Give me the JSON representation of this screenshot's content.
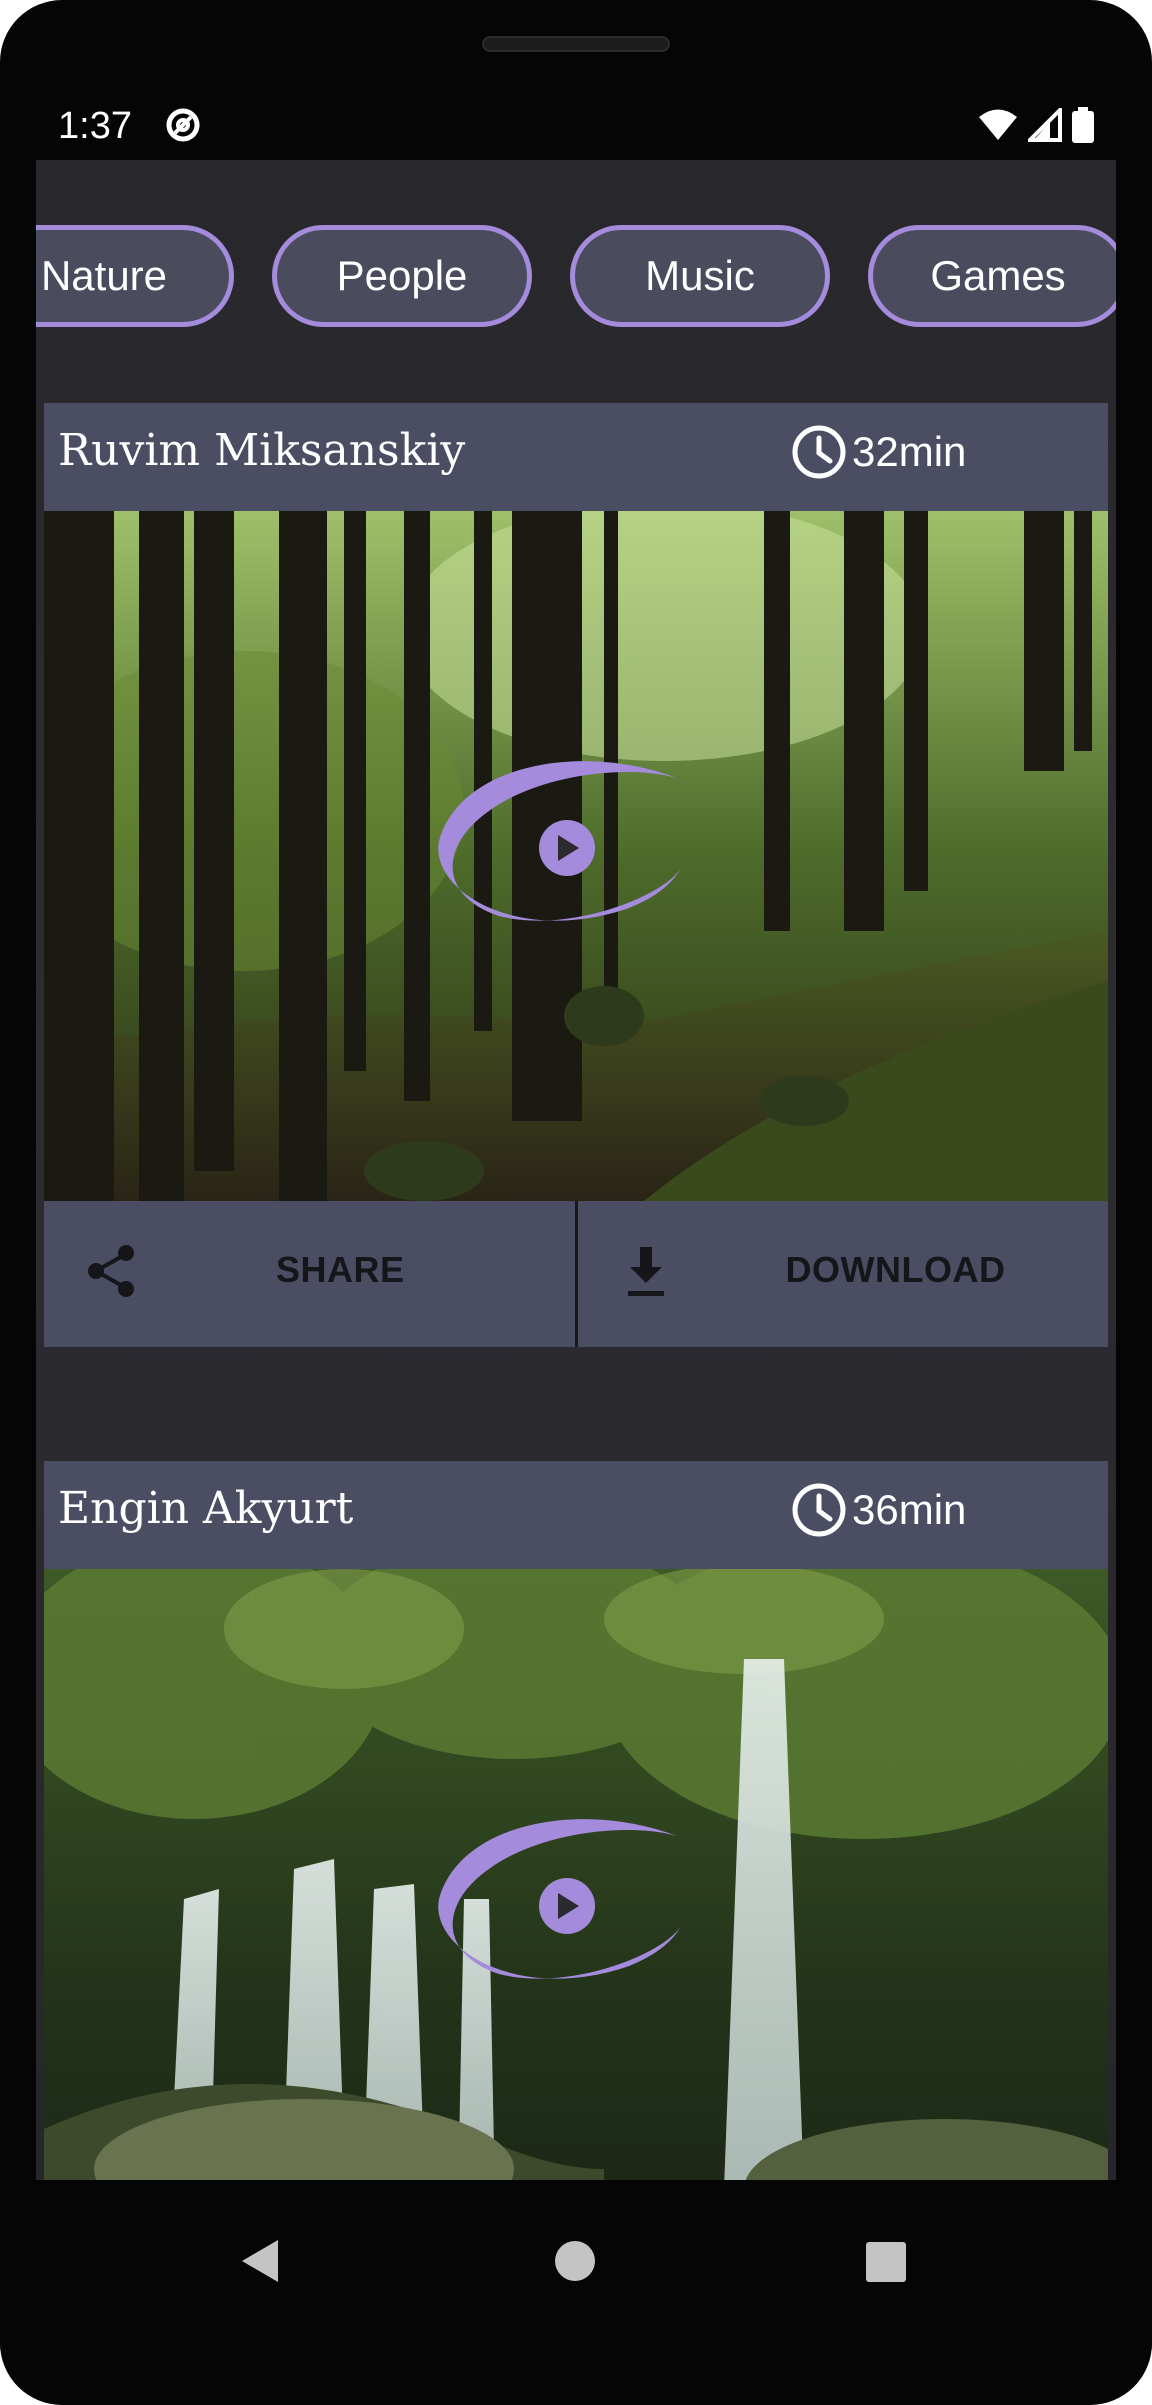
{
  "status_bar": {
    "time": "1:37"
  },
  "categories": [
    "Nature",
    "People",
    "Music",
    "Games"
  ],
  "videos": [
    {
      "author": "Ruvim Miksanskiy",
      "duration": "32min",
      "scene": "forest"
    },
    {
      "author": "Engin Akyurt",
      "duration": "36min",
      "scene": "waterfall"
    }
  ],
  "actions": {
    "share_label": "SHARE",
    "download_label": "DOWNLOAD"
  },
  "colors": {
    "accent": "#a48bdb",
    "surface": "#4b4d62",
    "background": "#2a2a2f"
  },
  "icons": {
    "clock": "clock-icon",
    "share": "share-icon",
    "download": "download-icon",
    "play": "play-icon"
  }
}
